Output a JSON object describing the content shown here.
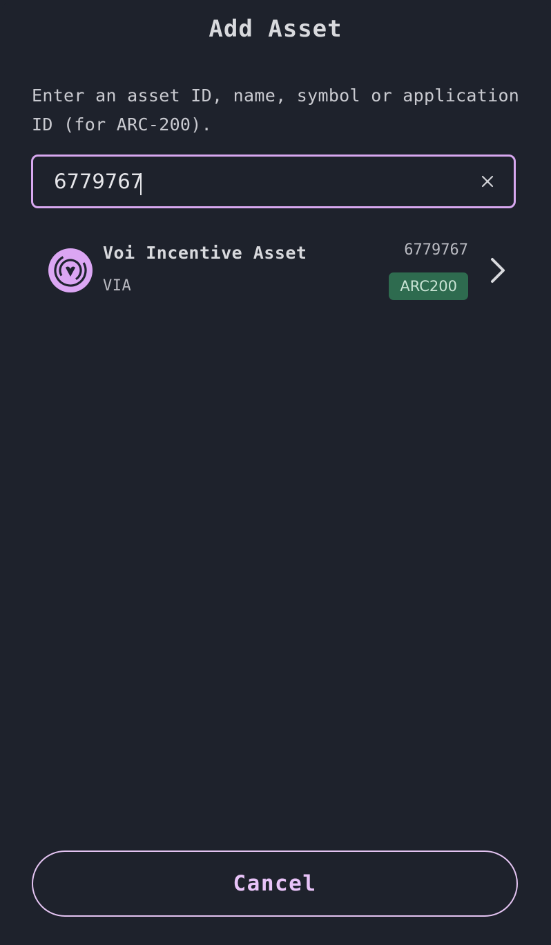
{
  "header": {
    "title": "Add Asset"
  },
  "description": "Enter an asset ID, name, symbol or application ID (for ARC-200).",
  "search": {
    "value": "6779767",
    "clear_icon": "close-icon"
  },
  "results": [
    {
      "name": "Voi Incentive Asset",
      "symbol": "VIA",
      "asset_id": "6779767",
      "standard": "ARC200",
      "icon": "voi-logo-icon",
      "chevron_icon": "chevron-right-icon"
    }
  ],
  "footer": {
    "cancel_label": "Cancel"
  },
  "colors": {
    "background": "#1e222c",
    "accent": "#d8a8f0",
    "badge": "#2e6b4f"
  }
}
